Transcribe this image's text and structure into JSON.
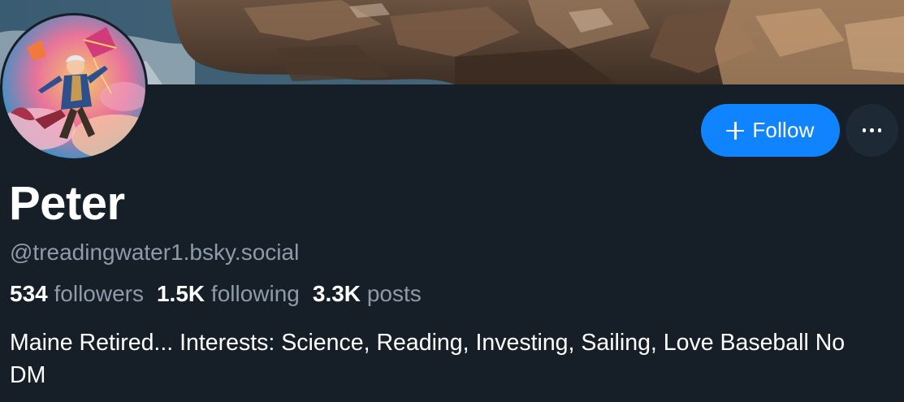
{
  "profile": {
    "display_name": "Peter",
    "handle": "@treadingwater1.bsky.social",
    "bio": "Maine Retired... Interests: Science, Reading, Investing, Sailing, Love Baseball No DM"
  },
  "stats": {
    "followers_count": "534",
    "followers_label": "followers",
    "following_count": "1.5K",
    "following_label": "following",
    "posts_count": "3.3K",
    "posts_label": "posts"
  },
  "actions": {
    "follow_label": "Follow",
    "follow_icon": "plus-icon",
    "more_icon": "ellipsis-icon"
  },
  "colors": {
    "background": "#161e27",
    "accent": "#1083fe",
    "muted_text": "#8d9baa",
    "secondary_button": "#1e2936"
  }
}
